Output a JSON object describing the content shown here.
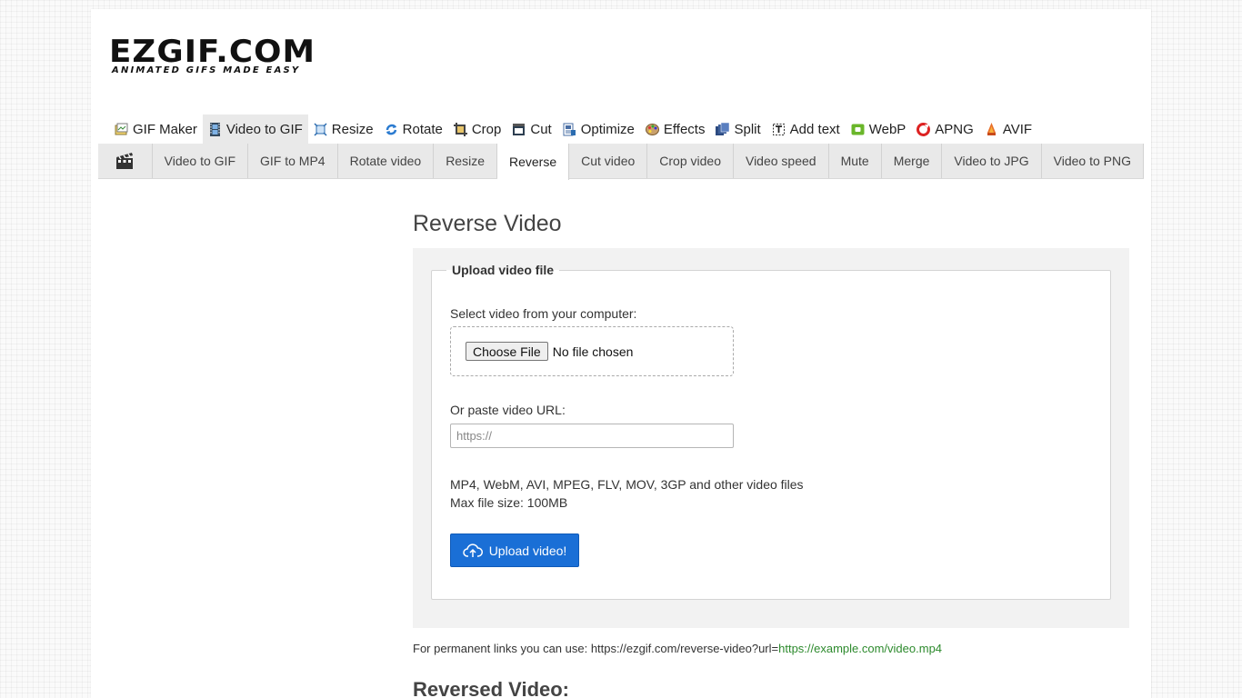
{
  "logo": {
    "main": "EZGIF.COM",
    "sub": "ANIMATED GIFS MADE EASY"
  },
  "topnav": [
    {
      "label": "GIF Maker",
      "icon": "gif-maker-icon"
    },
    {
      "label": "Video to GIF",
      "icon": "film-icon",
      "active": true
    },
    {
      "label": "Resize",
      "icon": "resize-icon"
    },
    {
      "label": "Rotate",
      "icon": "rotate-icon"
    },
    {
      "label": "Crop",
      "icon": "crop-icon"
    },
    {
      "label": "Cut",
      "icon": "cut-icon"
    },
    {
      "label": "Optimize",
      "icon": "optimize-icon"
    },
    {
      "label": "Effects",
      "icon": "palette-icon"
    },
    {
      "label": "Split",
      "icon": "split-icon"
    },
    {
      "label": "Add text",
      "icon": "add-text-icon"
    },
    {
      "label": "WebP",
      "icon": "webp-icon"
    },
    {
      "label": "APNG",
      "icon": "apng-icon"
    },
    {
      "label": "AVIF",
      "icon": "avif-icon"
    }
  ],
  "subnav": [
    "Video to GIF",
    "GIF to MP4",
    "Rotate video",
    "Resize",
    "Reverse",
    "Cut video",
    "Crop video",
    "Video speed",
    "Mute",
    "Merge",
    "Video to JPG",
    "Video to PNG"
  ],
  "subnav_active": "Reverse",
  "page": {
    "title": "Reverse Video",
    "legend": "Upload video file",
    "select_label": "Select video from your computer:",
    "choose_file": "Choose File",
    "no_file": "No file chosen",
    "url_label": "Or paste video URL:",
    "url_placeholder": "https://",
    "formats_line1": "MP4, WebM, AVI, MPEG, FLV, MOV, 3GP and other video files",
    "formats_line2": "Max file size: 100MB",
    "upload_button": "Upload video!",
    "permalink_prefix": "For permanent links you can use: https://ezgif.com/reverse-video?url=",
    "permalink_example": "https://example.com/video.mp4",
    "section2_title": "Reversed Video:"
  },
  "colors": {
    "accent": "#1a6fd6",
    "link_green": "#2d8a2d",
    "nav_bg": "#e9e9e9"
  }
}
